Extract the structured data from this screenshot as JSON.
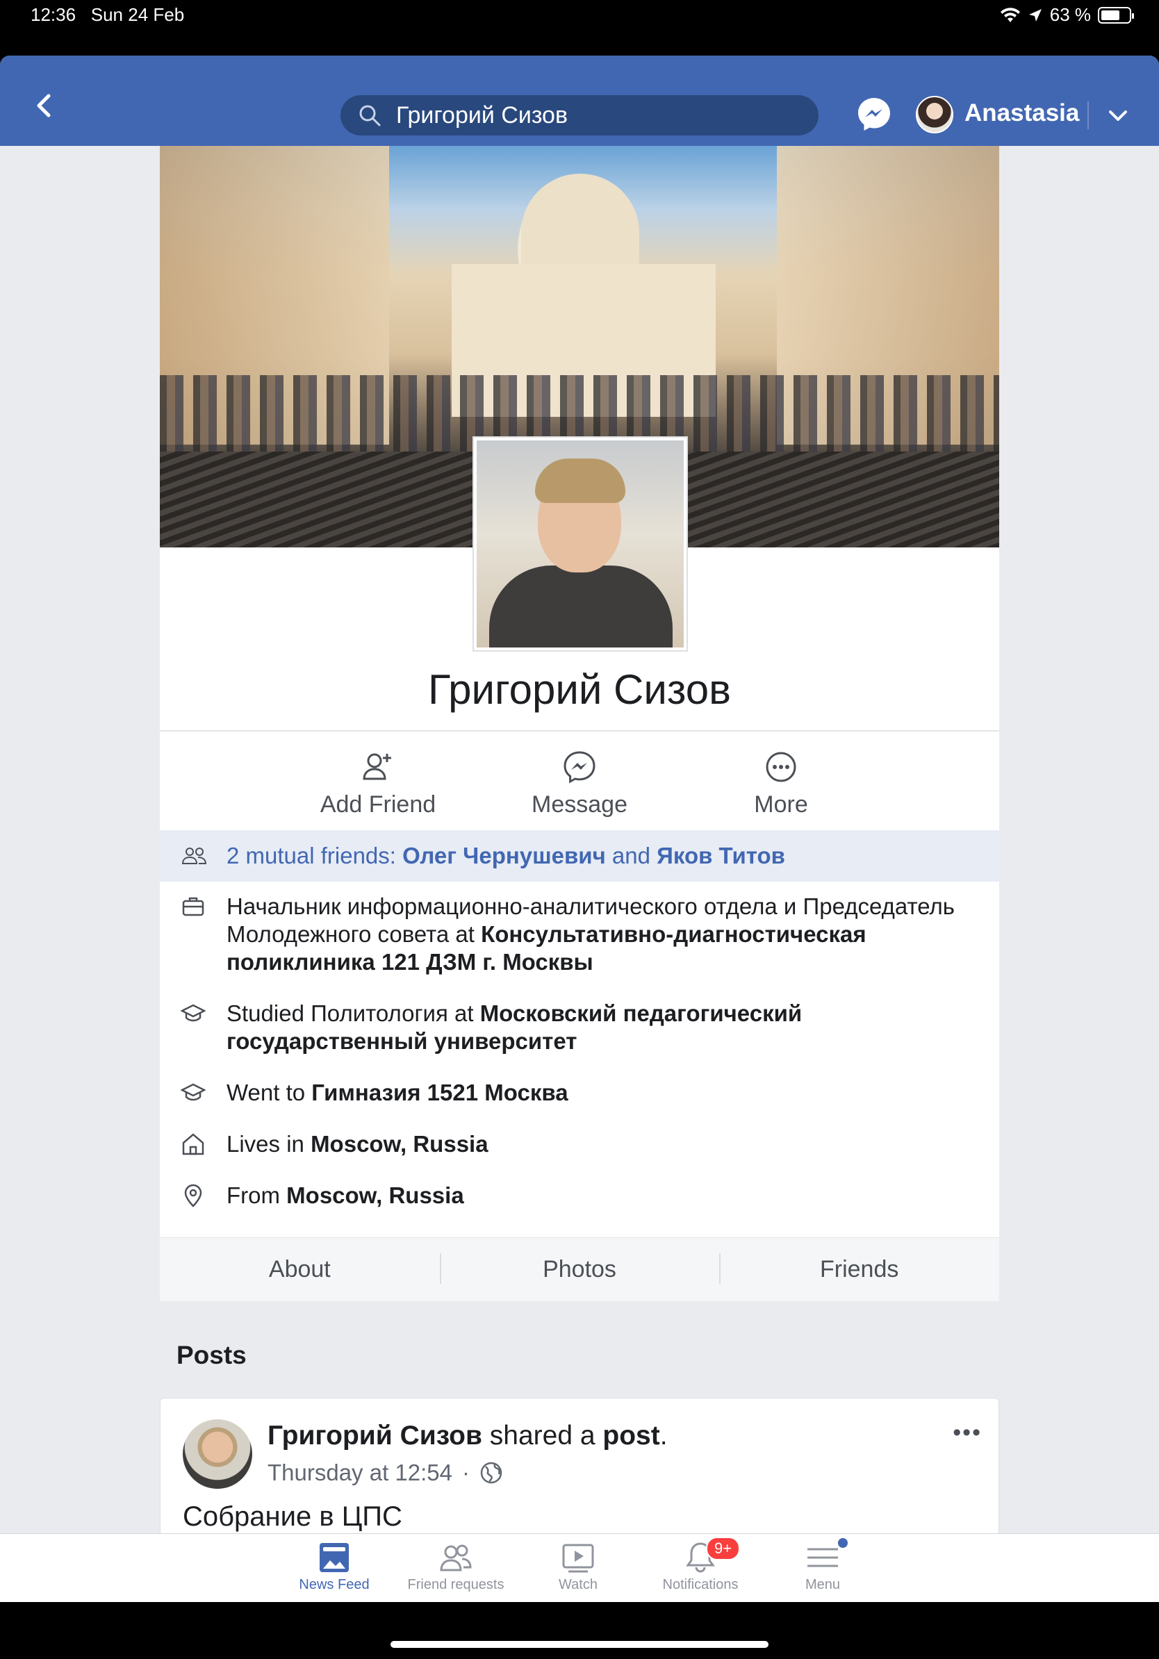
{
  "status_bar": {
    "time": "12:36",
    "date": "Sun 24 Feb",
    "battery": "63 %"
  },
  "nav": {
    "search_value": "Григорий Сизов",
    "user_name": "Anastasia"
  },
  "profile": {
    "name": "Григорий Сизов",
    "actions": {
      "add_friend": "Add Friend",
      "message": "Message",
      "more": "More"
    },
    "mutual": {
      "prefix": "2 mutual friends: ",
      "friend1": "Олег Чернушевич",
      "conj": " and ",
      "friend2": "Яков Титов"
    },
    "work": {
      "text": "Начальник информационно-аналитического отдела и Председатель Молодежного совета at ",
      "org": "Консультативно-диагностическая поликлиника 121 ДЗМ г. Москвы"
    },
    "studied": {
      "prefix": "Studied Политология at ",
      "school": "Московский педагогический государственный университет"
    },
    "went": {
      "prefix": "Went to ",
      "school": "Гимназия 1521 Москва"
    },
    "lives": {
      "prefix": "Lives in ",
      "place": "Moscow, Russia"
    },
    "from": {
      "prefix": "From ",
      "place": "Moscow, Russia"
    },
    "tabs": [
      "About",
      "Photos",
      "Friends"
    ]
  },
  "posts": {
    "heading": "Posts",
    "first": {
      "author": "Григорий Сизов",
      "action_text": " shared a ",
      "object": "post",
      "period": ".",
      "time": "Thursday at 12:54",
      "bullet": "·",
      "more": "•••",
      "text": "Собрание в ЦПС"
    }
  },
  "tabbar": {
    "items": [
      {
        "label": "News Feed"
      },
      {
        "label": "Friend requests"
      },
      {
        "label": "Watch"
      },
      {
        "label": "Notifications",
        "badge": "9+"
      },
      {
        "label": "Menu"
      }
    ]
  },
  "colors": {
    "brand": "#4267b2",
    "badge": "#fa3e3e"
  }
}
